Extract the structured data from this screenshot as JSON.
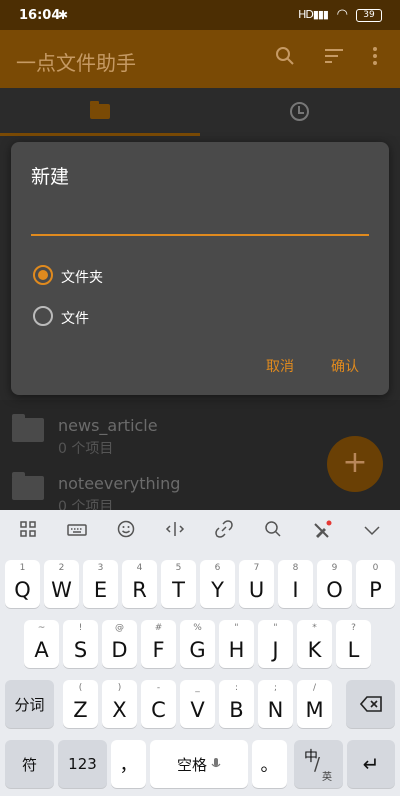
{
  "status": {
    "time": "16:04",
    "bluetooth": "✱",
    "signal": "HD",
    "battery": "39"
  },
  "appbar": {
    "title": "一点文件助手"
  },
  "files": [
    {
      "name": "news_article",
      "sub": "0 个项目"
    },
    {
      "name": "noteeverything",
      "sub": "0 个项目"
    }
  ],
  "fab_label": "+",
  "dialog": {
    "title": "新建",
    "input_value": "",
    "options": [
      "文件夹",
      "文件"
    ],
    "selected": "文件夹",
    "cancel": "取消",
    "confirm": "确认"
  },
  "keyboard": {
    "toolbar": [
      "grid-icon",
      "keyboard-icon",
      "emoji-icon",
      "cursor-icon",
      "link-icon",
      "search-icon",
      "brush-icon",
      "collapse-icon"
    ],
    "row1": [
      {
        "sub": "1",
        "key": "Q"
      },
      {
        "sub": "2",
        "key": "W"
      },
      {
        "sub": "3",
        "key": "E"
      },
      {
        "sub": "4",
        "key": "R"
      },
      {
        "sub": "5",
        "key": "T"
      },
      {
        "sub": "6",
        "key": "Y"
      },
      {
        "sub": "7",
        "key": "U"
      },
      {
        "sub": "8",
        "key": "I"
      },
      {
        "sub": "9",
        "key": "O"
      },
      {
        "sub": "0",
        "key": "P"
      }
    ],
    "row2": [
      {
        "sub": "~",
        "key": "A"
      },
      {
        "sub": "!",
        "key": "S"
      },
      {
        "sub": "@",
        "key": "D"
      },
      {
        "sub": "#",
        "key": "F"
      },
      {
        "sub": "%",
        "key": "G"
      },
      {
        "sub": "\"",
        "key": "H"
      },
      {
        "sub": "\"",
        "key": "J"
      },
      {
        "sub": "*",
        "key": "K"
      },
      {
        "sub": "?",
        "key": "L"
      }
    ],
    "row3": [
      {
        "sub": "(",
        "key": "Z"
      },
      {
        "sub": ")",
        "key": "X"
      },
      {
        "sub": "-",
        "key": "C"
      },
      {
        "sub": "_",
        "key": "V"
      },
      {
        "sub": ":",
        "key": "B"
      },
      {
        "sub": ";",
        "key": "N"
      },
      {
        "sub": "/",
        "key": "M"
      }
    ],
    "fenci": "分词",
    "backspace": "⌫",
    "fu": "符",
    "num": "123",
    "comma": "，",
    "space": "空格",
    "period": "。",
    "zhong": "中",
    "ying": "英",
    "enter": "↵"
  }
}
